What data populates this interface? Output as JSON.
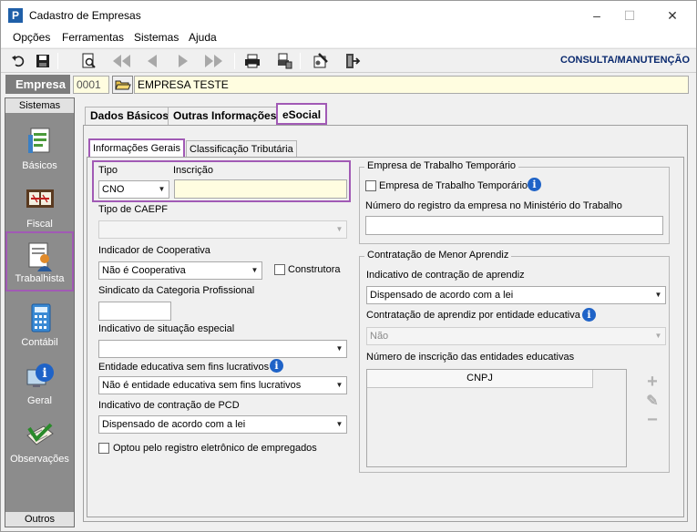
{
  "window": {
    "title": "Cadastro de Empresas",
    "controls": [
      "–",
      "☐",
      "✕"
    ]
  },
  "menu": [
    "Opções",
    "Ferramentas",
    "Sistemas",
    "Ajuda"
  ],
  "toolbar": {
    "buttons": [
      "undo-icon",
      "save-icon",
      "preview-icon",
      "first-icon",
      "prev-icon",
      "next-icon",
      "last-icon",
      "print-icon",
      "print-setup-icon",
      "tools-icon",
      "exit-icon"
    ],
    "mode_label": "CONSULTA/MANUTENÇÃO"
  },
  "company": {
    "label": "Empresa",
    "code": "0001",
    "name": "EMPRESA TESTE"
  },
  "sidebar": {
    "header": "Sistemas",
    "footer": "Outros",
    "items": [
      {
        "label": "Básicos",
        "icon": "basics-icon"
      },
      {
        "label": "Fiscal",
        "icon": "fiscal-icon"
      },
      {
        "label": "Trabalhista",
        "icon": "labor-icon",
        "active": true
      },
      {
        "label": "Contábil",
        "icon": "calculator-icon"
      },
      {
        "label": "Geral",
        "icon": "general-info-icon"
      },
      {
        "label": "Observações",
        "icon": "notes-icon"
      }
    ]
  },
  "tabs": {
    "main": [
      "Dados Básicos",
      "Outras Informações",
      "eSocial"
    ],
    "active_main": "eSocial",
    "sub": [
      "Informações Gerais",
      "Classificação Tributária"
    ],
    "active_sub": "Informações Gerais"
  },
  "form": {
    "tipo_label": "Tipo",
    "tipo_value": "CNO",
    "inscricao_label": "Inscrição",
    "inscricao_value": "",
    "caepf_label": "Tipo de CAEPF",
    "caepf_value": "",
    "cooperativa_label": "Indicador de Cooperativa",
    "cooperativa_value": "Não é Cooperativa",
    "construtora_label": "Construtora",
    "sindicato_label": "Sindicato da Categoria Profissional",
    "sindicato_value": "",
    "situacao_label": "Indicativo de situação especial",
    "situacao_value": "",
    "entidade_label": "Entidade educativa sem fins lucrativos",
    "entidade_value": "Não é entidade educativa sem fins lucrativos",
    "pcd_label": "Indicativo de contração de PCD",
    "pcd_value": "Dispensado de acordo com a lei",
    "registro_eletronico_label": "Optou pelo registro eletrônico de empregados"
  },
  "temp_work": {
    "group_title": "Empresa de Trabalho Temporário",
    "checkbox_label": "Empresa de Trabalho Temporário",
    "registro_label": "Número do registro da empresa no Ministério do Trabalho",
    "registro_value": ""
  },
  "apprentice": {
    "group_title": "Contratação de Menor Aprendiz",
    "indicativo_label": "Indicativo de contração de aprendiz",
    "indicativo_value": "Dispensado de acordo com a lei",
    "entidade_label": "Contratação de aprendiz por entidade educativa",
    "entidade_value": "Não",
    "inscricao_label": "Número de inscrição das entidades educativas",
    "grid_column": "CNPJ",
    "actions": [
      "+",
      "✎",
      "−"
    ]
  },
  "colors": {
    "highlight": "#a15ab5",
    "sidebar_bg": "#8c8c8c",
    "mode_label": "#0b2a6f",
    "input_yellow": "#fffde0",
    "info_blue": "#1f63c7"
  }
}
